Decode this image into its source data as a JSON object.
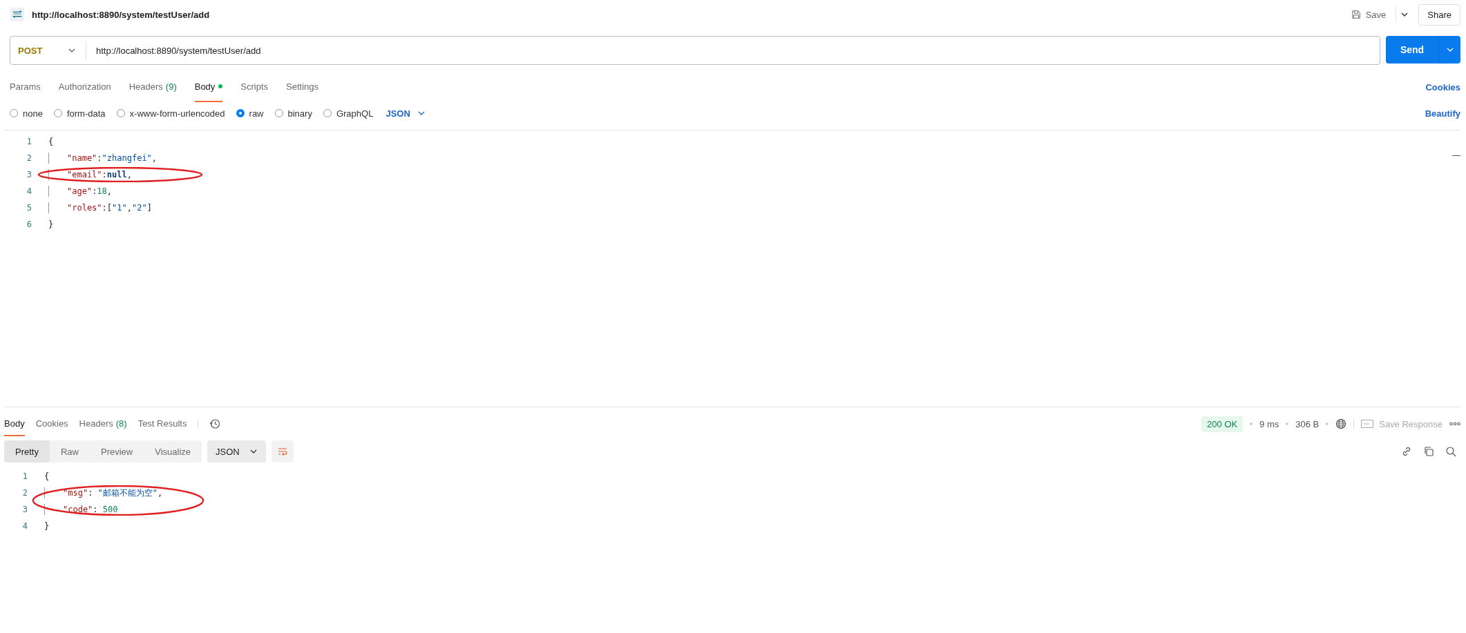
{
  "header": {
    "title": "http://localhost:8890/system/testUser/add",
    "save": "Save",
    "share": "Share"
  },
  "request": {
    "method": "POST",
    "url": "http://localhost:8890/system/testUser/add",
    "send": "Send"
  },
  "request_tabs": [
    {
      "label": "Params",
      "selected": false
    },
    {
      "label": "Authorization",
      "selected": false
    },
    {
      "label": "Headers",
      "count": "(9)",
      "selected": false
    },
    {
      "label": "Body",
      "dot": true,
      "selected": true
    },
    {
      "label": "Scripts",
      "selected": false
    },
    {
      "label": "Settings",
      "selected": false
    }
  ],
  "cookies_link": "Cookies",
  "body_types": [
    {
      "label": "none",
      "selected": false
    },
    {
      "label": "form-data",
      "selected": false
    },
    {
      "label": "x-www-form-urlencoded",
      "selected": false
    },
    {
      "label": "raw",
      "selected": true
    },
    {
      "label": "binary",
      "selected": false
    },
    {
      "label": "GraphQL",
      "selected": false
    }
  ],
  "format": "JSON",
  "beautify": "Beautify",
  "request_body": [
    {
      "number": "1",
      "indented": false,
      "tokens": [
        {
          "text": "{",
          "kind": "punct"
        }
      ]
    },
    {
      "number": "2",
      "indented": true,
      "tokens": [
        {
          "text": "\"name\"",
          "kind": "key"
        },
        {
          "text": ":",
          "kind": "punct"
        },
        {
          "text": "\"zhangfei\"",
          "kind": "string"
        },
        {
          "text": ",",
          "kind": "punct"
        }
      ]
    },
    {
      "number": "3",
      "indented": true,
      "tokens": [
        {
          "text": "\"email\"",
          "kind": "key"
        },
        {
          "text": ":",
          "kind": "punct"
        },
        {
          "text": "null",
          "kind": "keyword"
        },
        {
          "text": ",",
          "kind": "punct"
        }
      ]
    },
    {
      "number": "4",
      "indented": true,
      "tokens": [
        {
          "text": "\"age\"",
          "kind": "key"
        },
        {
          "text": ":",
          "kind": "punct"
        },
        {
          "text": "18",
          "kind": "number"
        },
        {
          "text": ",",
          "kind": "punct"
        }
      ]
    },
    {
      "number": "5",
      "indented": true,
      "tokens": [
        {
          "text": "\"roles\"",
          "kind": "key"
        },
        {
          "text": ":[",
          "kind": "punct"
        },
        {
          "text": "\"1\"",
          "kind": "string"
        },
        {
          "text": ",",
          "kind": "punct"
        },
        {
          "text": "\"2\"",
          "kind": "string"
        },
        {
          "text": "]",
          "kind": "punct"
        }
      ]
    },
    {
      "number": "6",
      "indented": false,
      "tokens": [
        {
          "text": "}",
          "kind": "punct"
        }
      ]
    }
  ],
  "response_tabs": [
    {
      "label": "Body",
      "selected": true
    },
    {
      "label": "Cookies",
      "selected": false
    },
    {
      "label": "Headers",
      "count": "(8)",
      "selected": false
    },
    {
      "label": "Test Results",
      "selected": false
    }
  ],
  "status": {
    "code": "200 OK",
    "time": "9 ms",
    "size": "306 B",
    "save_response": "Save Response"
  },
  "view_modes": [
    {
      "label": "Pretty",
      "selected": true
    },
    {
      "label": "Raw",
      "selected": false
    },
    {
      "label": "Preview",
      "selected": false
    },
    {
      "label": "Visualize",
      "selected": false
    }
  ],
  "response_format": "JSON",
  "response_body": [
    {
      "number": "1",
      "indented": false,
      "tokens": [
        {
          "text": "{",
          "kind": "punct"
        }
      ]
    },
    {
      "number": "2",
      "indented": true,
      "tokens": [
        {
          "text": "\"msg\"",
          "kind": "key"
        },
        {
          "text": ": ",
          "kind": "punct"
        },
        {
          "text": "\"邮箱不能为空\"",
          "kind": "string"
        },
        {
          "text": ",",
          "kind": "punct"
        }
      ]
    },
    {
      "number": "3",
      "indented": true,
      "tokens": [
        {
          "text": "\"code\"",
          "kind": "key"
        },
        {
          "text": ": ",
          "kind": "punct"
        },
        {
          "text": "500",
          "kind": "number"
        }
      ]
    },
    {
      "number": "4",
      "indented": false,
      "tokens": [
        {
          "text": "}",
          "kind": "punct"
        }
      ]
    }
  ]
}
